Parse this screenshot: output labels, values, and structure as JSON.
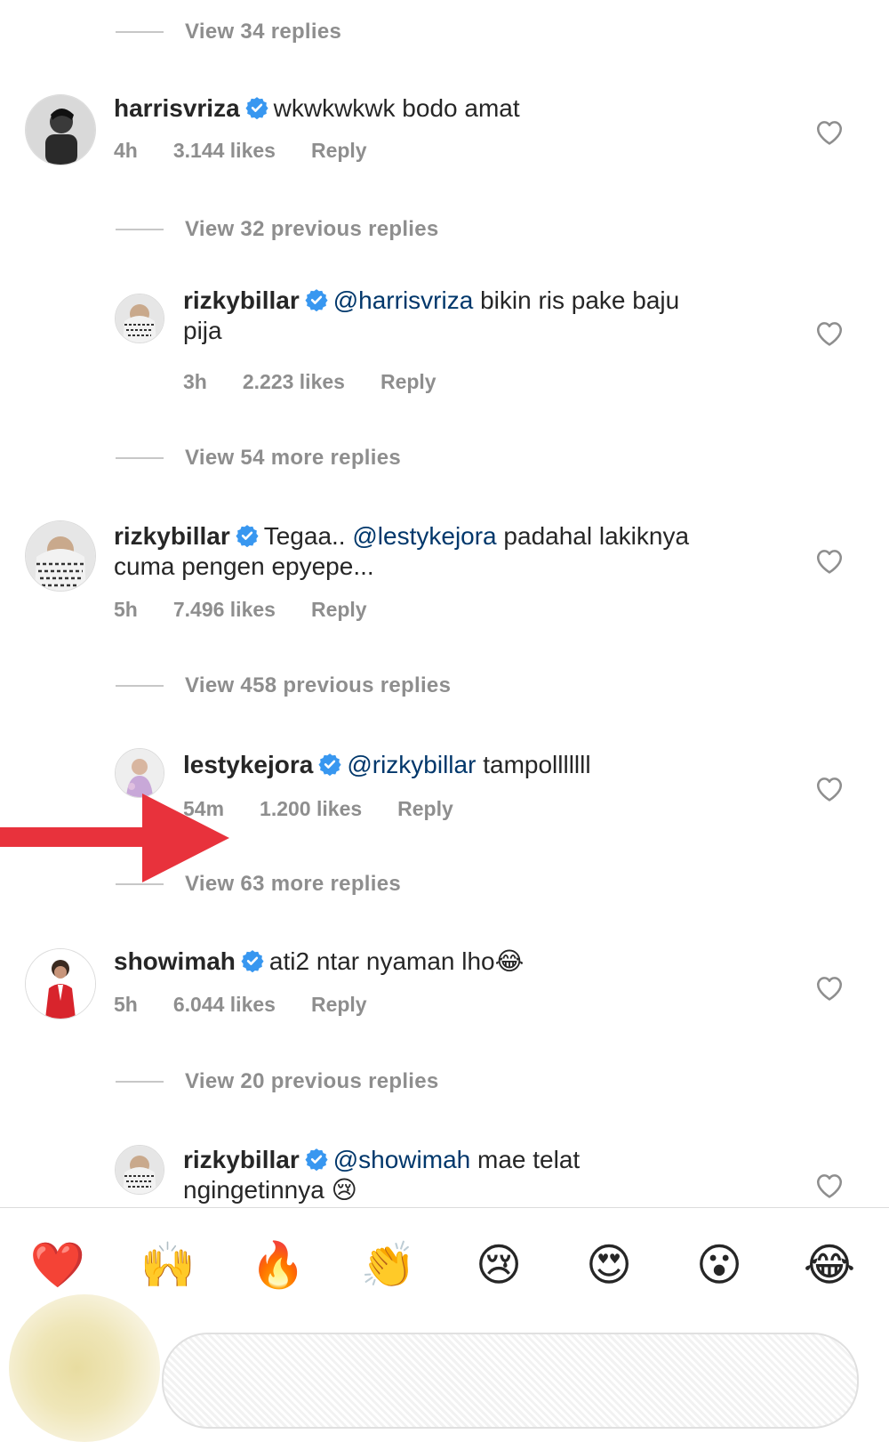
{
  "thread": [
    {
      "type": "view",
      "text": "View 34 replies"
    },
    {
      "type": "comment",
      "username": "harrisvriza",
      "text": "wkwkwkwk bodo amat",
      "time": "4h",
      "likes": "3.144 likes",
      "reply": "Reply"
    },
    {
      "type": "view",
      "text": "View 32 previous replies"
    },
    {
      "type": "reply",
      "username": "rizkybillar",
      "mention": "@harrisvriza",
      "text_line1": "bikin ris pake baju",
      "text_line2": "pija",
      "time": "3h",
      "likes": "2.223 likes",
      "reply": "Reply"
    },
    {
      "type": "view",
      "text": "View 54 more replies"
    },
    {
      "type": "comment",
      "username": "rizkybillar",
      "text_before": "Tegaa..",
      "mention": "@lestykejora",
      "text_after": "padahal lakiknya",
      "text_line2": "cuma pengen epyepe...",
      "time": "5h",
      "likes": "7.496 likes",
      "reply": "Reply"
    },
    {
      "type": "view",
      "text": "View 458 previous replies"
    },
    {
      "type": "reply",
      "username": "lestykejora",
      "mention": "@rizkybillar",
      "text": "tampolllllll",
      "time": "54m",
      "likes": "1.200 likes",
      "reply": "Reply"
    },
    {
      "type": "view",
      "text": "View 63 more replies"
    },
    {
      "type": "comment",
      "username": "showimah",
      "text": "ati2 ntar nyaman lho",
      "emoji": "😂",
      "time": "5h",
      "likes": "6.044 likes",
      "reply": "Reply"
    },
    {
      "type": "view",
      "text": "View 20 previous replies"
    },
    {
      "type": "reply",
      "username": "rizkybillar",
      "mention": "@showimah",
      "text_line1": "mae telat",
      "text_line2": "ngingetinnya",
      "emoji": "😢"
    }
  ],
  "reactions": [
    "❤️",
    "🙌",
    "🔥",
    "👏",
    "😢",
    "😍",
    "😮",
    "😂"
  ],
  "icons": {
    "like": "heart-outline-icon",
    "verified": "verified-badge-icon",
    "annotation": "red-arrow"
  },
  "colors": {
    "mention": "#00376b",
    "meta": "#8e8e8e",
    "verified": "#3897f0",
    "arrow": "#e8323c"
  }
}
